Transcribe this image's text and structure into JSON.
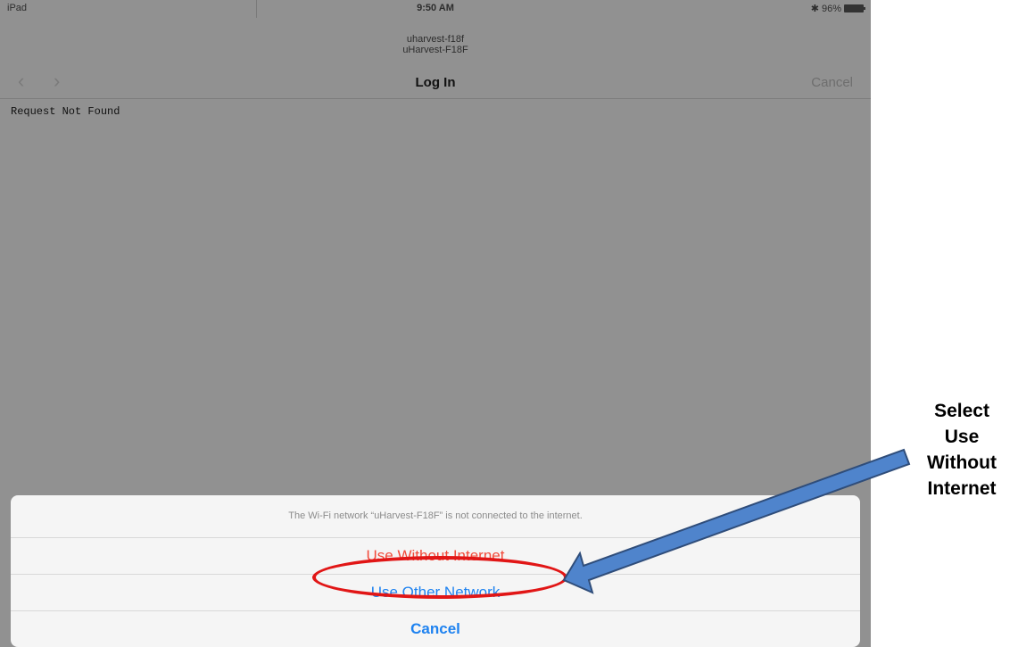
{
  "status_bar": {
    "device": "iPad",
    "time": "9:50 AM",
    "battery": "96%"
  },
  "network": {
    "ssid_line1": "uharvest-f18f",
    "ssid_line2": "uHarvest-F18F"
  },
  "nav": {
    "title": "Log In",
    "cancel_label": "Cancel",
    "back_icon": "chevron-left-icon",
    "forward_icon": "chevron-right-icon"
  },
  "page": {
    "content_text": "Request Not Found"
  },
  "action_sheet": {
    "message": "The Wi-Fi network “uHarvest-F18F” is not connected to the internet.",
    "options": [
      "Use Without Internet",
      "Use Other Network"
    ],
    "cancel_label": "Cancel"
  },
  "annotation": {
    "lines": [
      "Select",
      "Use",
      "Without",
      "Internet"
    ]
  },
  "colors": {
    "highlight": "#e11616",
    "arrow": "#4f84cc",
    "destructive": "#f24a3a",
    "link": "#1e82f0"
  }
}
